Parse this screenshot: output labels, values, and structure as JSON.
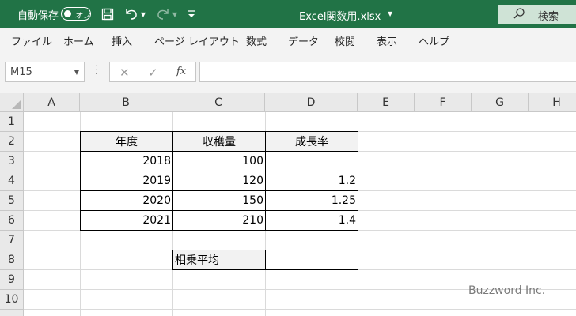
{
  "titlebar": {
    "autosave_label": "自動保存",
    "autosave_state": "オフ",
    "doc_title": "Excel関数用.xlsx",
    "search_label": "検索",
    "accent_color": "#217346"
  },
  "ribbon": {
    "tabs": [
      "ファイル",
      "ホーム",
      "挿入",
      "ページ レイアウト",
      "数式",
      "データ",
      "校閲",
      "表示",
      "ヘルプ"
    ]
  },
  "formula_bar": {
    "name_box": "M15",
    "fx_label": "fx",
    "formula": ""
  },
  "grid": {
    "columns": [
      "A",
      "B",
      "C",
      "D",
      "E",
      "F",
      "G",
      "H"
    ],
    "rows": [
      "1",
      "2",
      "3",
      "4",
      "5",
      "6",
      "7",
      "8",
      "9",
      "10"
    ],
    "table": {
      "headers": [
        "年度",
        "収穫量",
        "成長率"
      ],
      "rows": [
        [
          "2018",
          "100",
          ""
        ],
        [
          "2019",
          "120",
          "1.2"
        ],
        [
          "2020",
          "150",
          "1.25"
        ],
        [
          "2021",
          "210",
          "1.4"
        ]
      ]
    },
    "geo_mean": {
      "label": "相乗平均",
      "value": ""
    }
  },
  "watermark": "Buzzword Inc."
}
